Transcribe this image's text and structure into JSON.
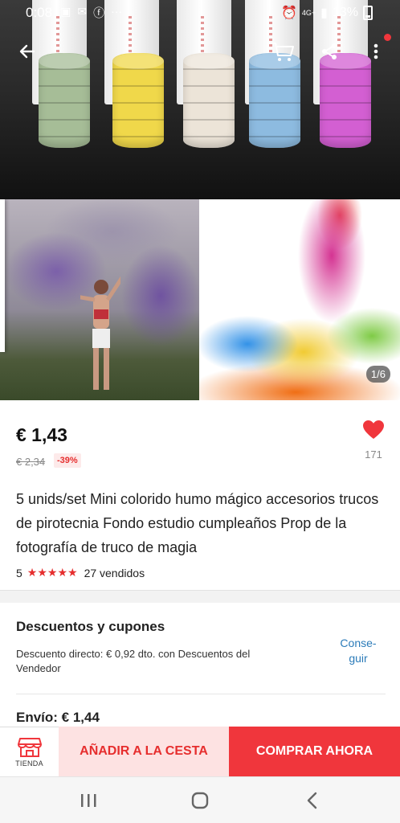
{
  "status_bar": {
    "time": "0:08",
    "battery": "13%",
    "network": "4G+",
    "notif_icons": [
      "image-icon",
      "gmail-icon",
      "facebook-icon",
      "more-dots"
    ]
  },
  "gallery": {
    "counter": "1/6"
  },
  "product": {
    "price": "€ 1,43",
    "old_price": "€ 2,34",
    "discount": "-39%",
    "wishlist_count": "171",
    "title": "5 unids/set Mini colorido humo mágico accesorios trucos de pirotecnia Fondo estudio cumpleaños Prop de la fotografía de truco de magia",
    "rating": "5",
    "stars": "★★★★★",
    "sold": "27 vendidos"
  },
  "coupons": {
    "title": "Descuentos y cupones",
    "text": "Descuento directo: € 0,92 dto. con Descuentos del Vendedor",
    "get_label": "Conse-\nguir"
  },
  "shipping": {
    "text": "Envío: € 1,44"
  },
  "action_bar": {
    "store_label": "TIENDA",
    "add_to_cart": "AÑADIR A LA CESTA",
    "buy_now": "COMPRAR AHORA"
  },
  "colors": {
    "accent_red": "#f0363c",
    "link_blue": "#2b7bb9",
    "cart_bg": "#fde2e2"
  },
  "smoke_stacks": [
    "#a6bd97",
    "#f0d84a",
    "#ece4d8",
    "#8dbbe0",
    "#d35fd2"
  ]
}
